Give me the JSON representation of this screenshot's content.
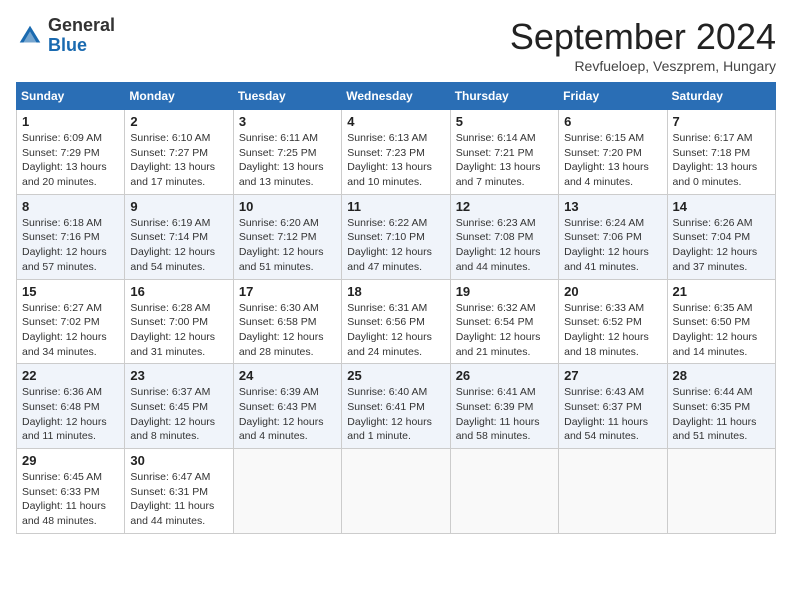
{
  "header": {
    "logo": {
      "line1": "General",
      "line2": "Blue"
    },
    "title": "September 2024",
    "subtitle": "Revfueloep, Veszprem, Hungary"
  },
  "days_of_week": [
    "Sunday",
    "Monday",
    "Tuesday",
    "Wednesday",
    "Thursday",
    "Friday",
    "Saturday"
  ],
  "weeks": [
    [
      {
        "day": "1",
        "sunrise": "Sunrise: 6:09 AM",
        "sunset": "Sunset: 7:29 PM",
        "daylight": "Daylight: 13 hours and 20 minutes."
      },
      {
        "day": "2",
        "sunrise": "Sunrise: 6:10 AM",
        "sunset": "Sunset: 7:27 PM",
        "daylight": "Daylight: 13 hours and 17 minutes."
      },
      {
        "day": "3",
        "sunrise": "Sunrise: 6:11 AM",
        "sunset": "Sunset: 7:25 PM",
        "daylight": "Daylight: 13 hours and 13 minutes."
      },
      {
        "day": "4",
        "sunrise": "Sunrise: 6:13 AM",
        "sunset": "Sunset: 7:23 PM",
        "daylight": "Daylight: 13 hours and 10 minutes."
      },
      {
        "day": "5",
        "sunrise": "Sunrise: 6:14 AM",
        "sunset": "Sunset: 7:21 PM",
        "daylight": "Daylight: 13 hours and 7 minutes."
      },
      {
        "day": "6",
        "sunrise": "Sunrise: 6:15 AM",
        "sunset": "Sunset: 7:20 PM",
        "daylight": "Daylight: 13 hours and 4 minutes."
      },
      {
        "day": "7",
        "sunrise": "Sunrise: 6:17 AM",
        "sunset": "Sunset: 7:18 PM",
        "daylight": "Daylight: 13 hours and 0 minutes."
      }
    ],
    [
      {
        "day": "8",
        "sunrise": "Sunrise: 6:18 AM",
        "sunset": "Sunset: 7:16 PM",
        "daylight": "Daylight: 12 hours and 57 minutes."
      },
      {
        "day": "9",
        "sunrise": "Sunrise: 6:19 AM",
        "sunset": "Sunset: 7:14 PM",
        "daylight": "Daylight: 12 hours and 54 minutes."
      },
      {
        "day": "10",
        "sunrise": "Sunrise: 6:20 AM",
        "sunset": "Sunset: 7:12 PM",
        "daylight": "Daylight: 12 hours and 51 minutes."
      },
      {
        "day": "11",
        "sunrise": "Sunrise: 6:22 AM",
        "sunset": "Sunset: 7:10 PM",
        "daylight": "Daylight: 12 hours and 47 minutes."
      },
      {
        "day": "12",
        "sunrise": "Sunrise: 6:23 AM",
        "sunset": "Sunset: 7:08 PM",
        "daylight": "Daylight: 12 hours and 44 minutes."
      },
      {
        "day": "13",
        "sunrise": "Sunrise: 6:24 AM",
        "sunset": "Sunset: 7:06 PM",
        "daylight": "Daylight: 12 hours and 41 minutes."
      },
      {
        "day": "14",
        "sunrise": "Sunrise: 6:26 AM",
        "sunset": "Sunset: 7:04 PM",
        "daylight": "Daylight: 12 hours and 37 minutes."
      }
    ],
    [
      {
        "day": "15",
        "sunrise": "Sunrise: 6:27 AM",
        "sunset": "Sunset: 7:02 PM",
        "daylight": "Daylight: 12 hours and 34 minutes."
      },
      {
        "day": "16",
        "sunrise": "Sunrise: 6:28 AM",
        "sunset": "Sunset: 7:00 PM",
        "daylight": "Daylight: 12 hours and 31 minutes."
      },
      {
        "day": "17",
        "sunrise": "Sunrise: 6:30 AM",
        "sunset": "Sunset: 6:58 PM",
        "daylight": "Daylight: 12 hours and 28 minutes."
      },
      {
        "day": "18",
        "sunrise": "Sunrise: 6:31 AM",
        "sunset": "Sunset: 6:56 PM",
        "daylight": "Daylight: 12 hours and 24 minutes."
      },
      {
        "day": "19",
        "sunrise": "Sunrise: 6:32 AM",
        "sunset": "Sunset: 6:54 PM",
        "daylight": "Daylight: 12 hours and 21 minutes."
      },
      {
        "day": "20",
        "sunrise": "Sunrise: 6:33 AM",
        "sunset": "Sunset: 6:52 PM",
        "daylight": "Daylight: 12 hours and 18 minutes."
      },
      {
        "day": "21",
        "sunrise": "Sunrise: 6:35 AM",
        "sunset": "Sunset: 6:50 PM",
        "daylight": "Daylight: 12 hours and 14 minutes."
      }
    ],
    [
      {
        "day": "22",
        "sunrise": "Sunrise: 6:36 AM",
        "sunset": "Sunset: 6:48 PM",
        "daylight": "Daylight: 12 hours and 11 minutes."
      },
      {
        "day": "23",
        "sunrise": "Sunrise: 6:37 AM",
        "sunset": "Sunset: 6:45 PM",
        "daylight": "Daylight: 12 hours and 8 minutes."
      },
      {
        "day": "24",
        "sunrise": "Sunrise: 6:39 AM",
        "sunset": "Sunset: 6:43 PM",
        "daylight": "Daylight: 12 hours and 4 minutes."
      },
      {
        "day": "25",
        "sunrise": "Sunrise: 6:40 AM",
        "sunset": "Sunset: 6:41 PM",
        "daylight": "Daylight: 12 hours and 1 minute."
      },
      {
        "day": "26",
        "sunrise": "Sunrise: 6:41 AM",
        "sunset": "Sunset: 6:39 PM",
        "daylight": "Daylight: 11 hours and 58 minutes."
      },
      {
        "day": "27",
        "sunrise": "Sunrise: 6:43 AM",
        "sunset": "Sunset: 6:37 PM",
        "daylight": "Daylight: 11 hours and 54 minutes."
      },
      {
        "day": "28",
        "sunrise": "Sunrise: 6:44 AM",
        "sunset": "Sunset: 6:35 PM",
        "daylight": "Daylight: 11 hours and 51 minutes."
      }
    ],
    [
      {
        "day": "29",
        "sunrise": "Sunrise: 6:45 AM",
        "sunset": "Sunset: 6:33 PM",
        "daylight": "Daylight: 11 hours and 48 minutes."
      },
      {
        "day": "30",
        "sunrise": "Sunrise: 6:47 AM",
        "sunset": "Sunset: 6:31 PM",
        "daylight": "Daylight: 11 hours and 44 minutes."
      },
      null,
      null,
      null,
      null,
      null
    ]
  ]
}
